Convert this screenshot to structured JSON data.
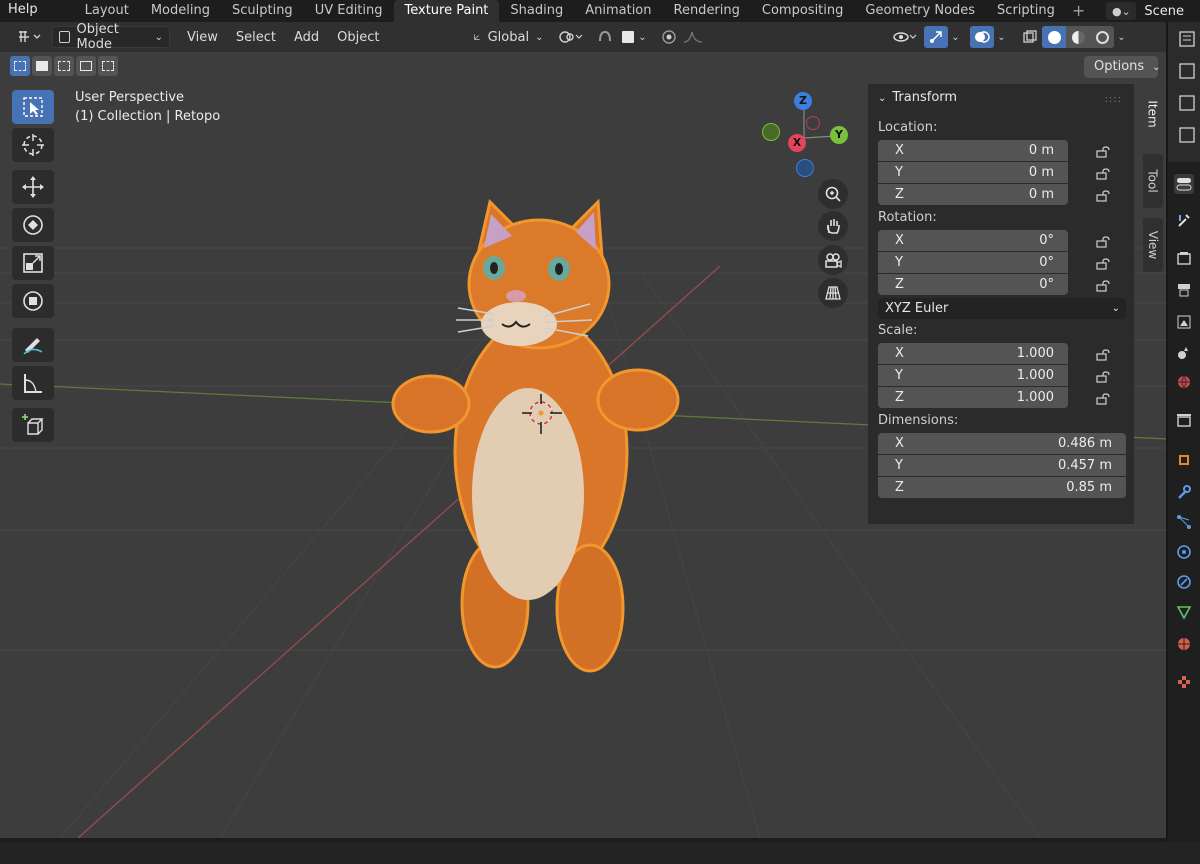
{
  "topbar": {
    "help_label": "Help",
    "tabs": [
      "Layout",
      "Modeling",
      "Sculpting",
      "UV Editing",
      "Texture Paint",
      "Shading",
      "Animation",
      "Rendering",
      "Compositing",
      "Geometry Nodes",
      "Scripting"
    ],
    "active_tab": "Texture Paint",
    "add_tab_icon": "plus-icon",
    "scene_label": "Scene"
  },
  "header": {
    "mode_label": "Object Mode",
    "menu": [
      "View",
      "Select",
      "Add",
      "Object"
    ],
    "orientation_label": "Global"
  },
  "viewport": {
    "options_label": "Options",
    "view_name": "User Perspective",
    "collection": "(1) Collection | Retopo",
    "gizmo": {
      "z": "Z",
      "y": "Y",
      "x": "X"
    }
  },
  "npanel": {
    "title": "Transform",
    "location_label": "Location:",
    "location": [
      {
        "axis": "X",
        "value": "0 m"
      },
      {
        "axis": "Y",
        "value": "0 m"
      },
      {
        "axis": "Z",
        "value": "0 m"
      }
    ],
    "rotation_label": "Rotation:",
    "rotation": [
      {
        "axis": "X",
        "value": "0°"
      },
      {
        "axis": "Y",
        "value": "0°"
      },
      {
        "axis": "Z",
        "value": "0°"
      }
    ],
    "rotation_mode": "XYZ Euler",
    "scale_label": "Scale:",
    "scale": [
      {
        "axis": "X",
        "value": "1.000"
      },
      {
        "axis": "Y",
        "value": "1.000"
      },
      {
        "axis": "Z",
        "value": "1.000"
      }
    ],
    "dimensions_label": "Dimensions:",
    "dimensions": [
      {
        "axis": "X",
        "value": "0.486 m"
      },
      {
        "axis": "Y",
        "value": "0.457 m"
      },
      {
        "axis": "Z",
        "value": "0.85 m"
      }
    ],
    "tabs": [
      "Item",
      "Tool",
      "View"
    ]
  },
  "colors": {
    "accent": "#4772b3",
    "x_axis": "#e2445c",
    "y_axis": "#7ac03a",
    "z_axis": "#3a7fe0",
    "selection_outline": "#f0922c"
  }
}
